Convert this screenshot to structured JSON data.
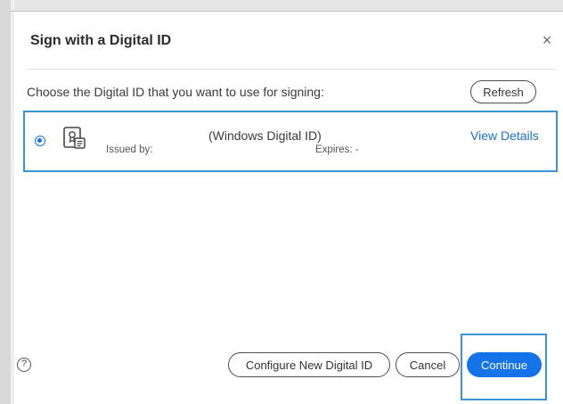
{
  "dialog": {
    "title": "Sign with a Digital ID",
    "close_label": "×",
    "prompt": "Choose the Digital ID that you want to use for signing:",
    "refresh_label": "Refresh"
  },
  "digital_id": {
    "name": "(Windows Digital ID)",
    "issued_by_label": "Issued by:",
    "expires_label": "Expires: -",
    "view_details_label": "View Details",
    "selected": true
  },
  "footer": {
    "help_label": "?",
    "configure_label": "Configure New Digital ID",
    "cancel_label": "Cancel",
    "continue_label": "Continue"
  },
  "colors": {
    "accent": "#1473e6",
    "highlight_border": "#3b93d3",
    "link": "#1a6fd0"
  },
  "icons": {
    "close": "close-icon",
    "radio": "radio-selected-icon",
    "certificate": "certificate-icon",
    "help": "help-icon"
  }
}
